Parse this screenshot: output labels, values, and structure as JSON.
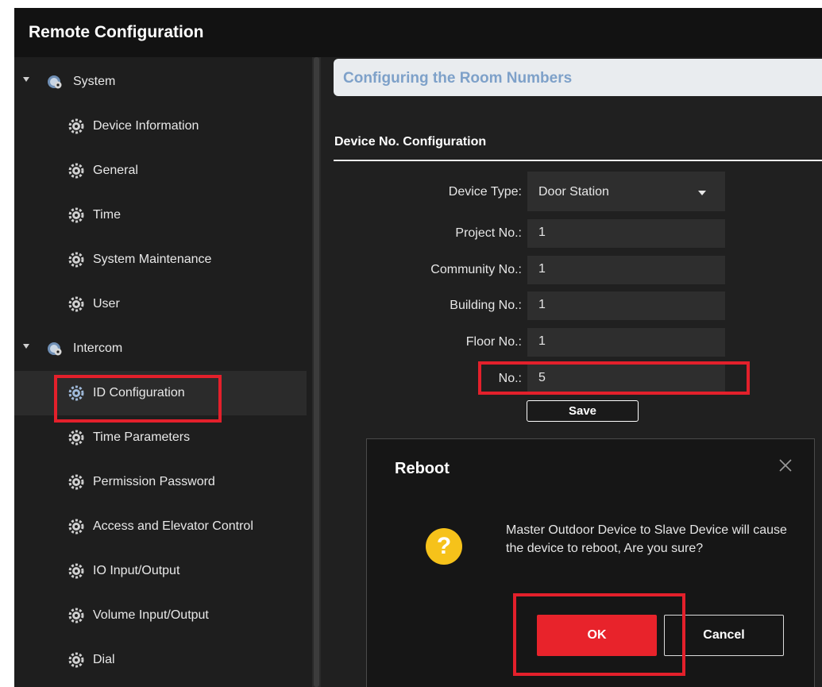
{
  "window": {
    "title": "Remote Configuration"
  },
  "sidebar": {
    "groups": [
      {
        "label": "System",
        "icon": "gears-icon"
      },
      {
        "label": "Intercom",
        "icon": "gears-icon"
      }
    ],
    "items": [
      {
        "label": "Device Information",
        "icon": "gear-icon"
      },
      {
        "label": "General",
        "icon": "gear-icon"
      },
      {
        "label": "Time",
        "icon": "gear-icon"
      },
      {
        "label": "System Maintenance",
        "icon": "gear-icon"
      },
      {
        "label": "User",
        "icon": "gear-icon"
      },
      {
        "label": "ID Configuration",
        "icon": "gear-icon",
        "active": true
      },
      {
        "label": "Time Parameters",
        "icon": "gear-icon"
      },
      {
        "label": "Permission Password",
        "icon": "gear-icon"
      },
      {
        "label": "Access and Elevator Control",
        "icon": "gear-icon"
      },
      {
        "label": "IO Input/Output",
        "icon": "gear-icon"
      },
      {
        "label": "Volume Input/Output",
        "icon": "gear-icon"
      },
      {
        "label": "Dial",
        "icon": "gear-icon"
      }
    ]
  },
  "main": {
    "tab_title": "Configuring the Room Numbers",
    "section_title": "Device No. Configuration",
    "form": {
      "device_type": {
        "label": "Device Type:",
        "value": "Door Station"
      },
      "project_no": {
        "label": "Project No.:",
        "value": "1"
      },
      "community_no": {
        "label": "Community No.:",
        "value": "1"
      },
      "building_no": {
        "label": "Building No.:",
        "value": "1"
      },
      "floor_no": {
        "label": "Floor No.:",
        "value": "1"
      },
      "no": {
        "label": "No.:",
        "value": "5"
      }
    },
    "save_label": "Save"
  },
  "dialog": {
    "title": "Reboot",
    "message": "Master Outdoor Device to Slave Device will cause the device to reboot, Are you sure?",
    "icon_glyph": "?",
    "ok_label": "OK",
    "cancel_label": "Cancel"
  },
  "colors": {
    "highlight_red": "#e3202b",
    "ok_button": "#e8232b",
    "question_icon": "#f6c21a",
    "tab_title": "#7ea1c9"
  }
}
